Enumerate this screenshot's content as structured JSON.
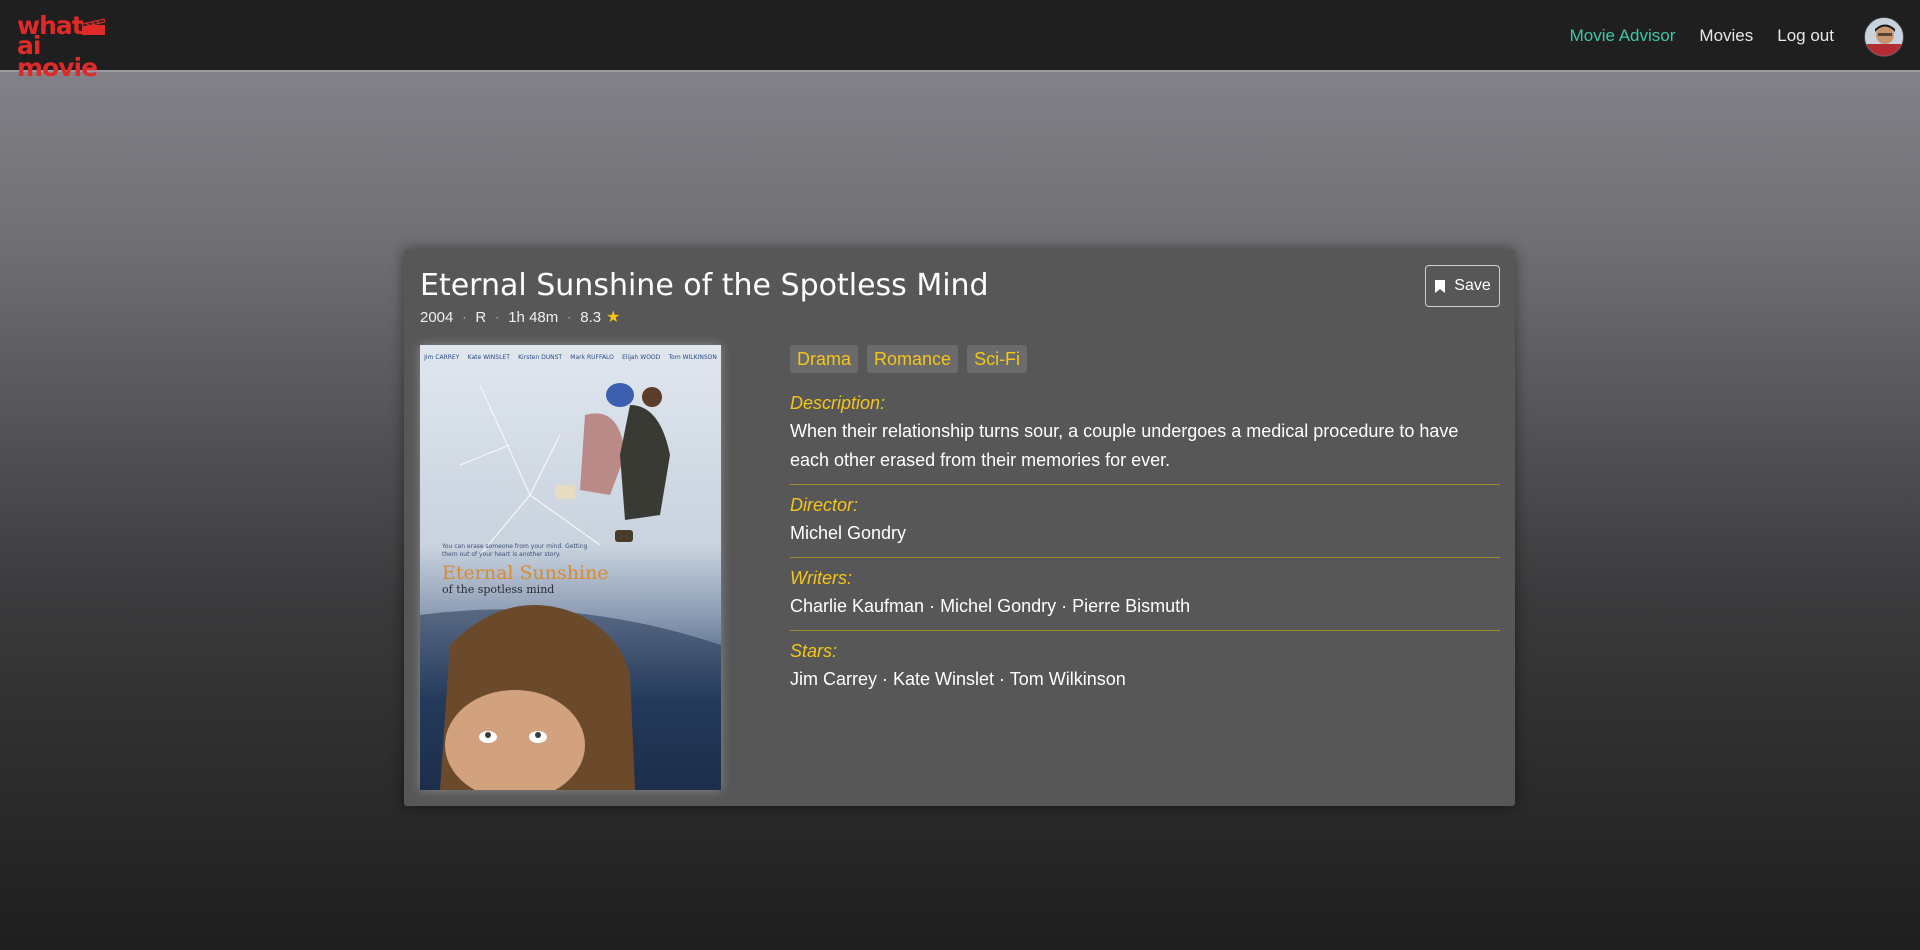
{
  "brand": {
    "line1": "what",
    "line2": "movie",
    "accent_color": "#e02a2a"
  },
  "nav": {
    "links": [
      {
        "label": "Movie Advisor",
        "active": true
      },
      {
        "label": "Movies",
        "active": false
      },
      {
        "label": "Log out",
        "active": false
      }
    ],
    "avatar_icon": "user-avatar"
  },
  "movie": {
    "title": "Eternal Sunshine of the Spotless Mind",
    "year": "2004",
    "rating_cert": "R",
    "runtime": "1h 48m",
    "score": "8.3",
    "save_label": "Save",
    "genres": [
      "Drama",
      "Romance",
      "Sci-Fi"
    ],
    "description_label": "Description:",
    "description": "When their relationship turns sour, a couple undergoes a medical procedure to have each other erased from their memories for ever.",
    "director_label": "Director:",
    "director": "Michel Gondry",
    "writers_label": "Writers:",
    "writers": "Charlie Kaufman · Michel Gondry · Pierre Bismuth",
    "stars_label": "Stars:",
    "stars": "Jim Carrey · Kate Winslet · Tom Wilkinson",
    "poster": {
      "cast": [
        "Jim CARREY",
        "Kate WINSLET",
        "Kirsten DUNST",
        "Mark RUFFALO",
        "Elijah WOOD",
        "Tom WILKINSON"
      ],
      "tagline": "You can erase someone from your mind. Getting them out of your heart is another story.",
      "title_line1": "Eternal Sunshine",
      "title_line2": "of the spotless mind"
    }
  },
  "colors": {
    "accent_gold": "#f5c518",
    "nav_active": "#3ec7a5",
    "card_bg": "#575757"
  }
}
